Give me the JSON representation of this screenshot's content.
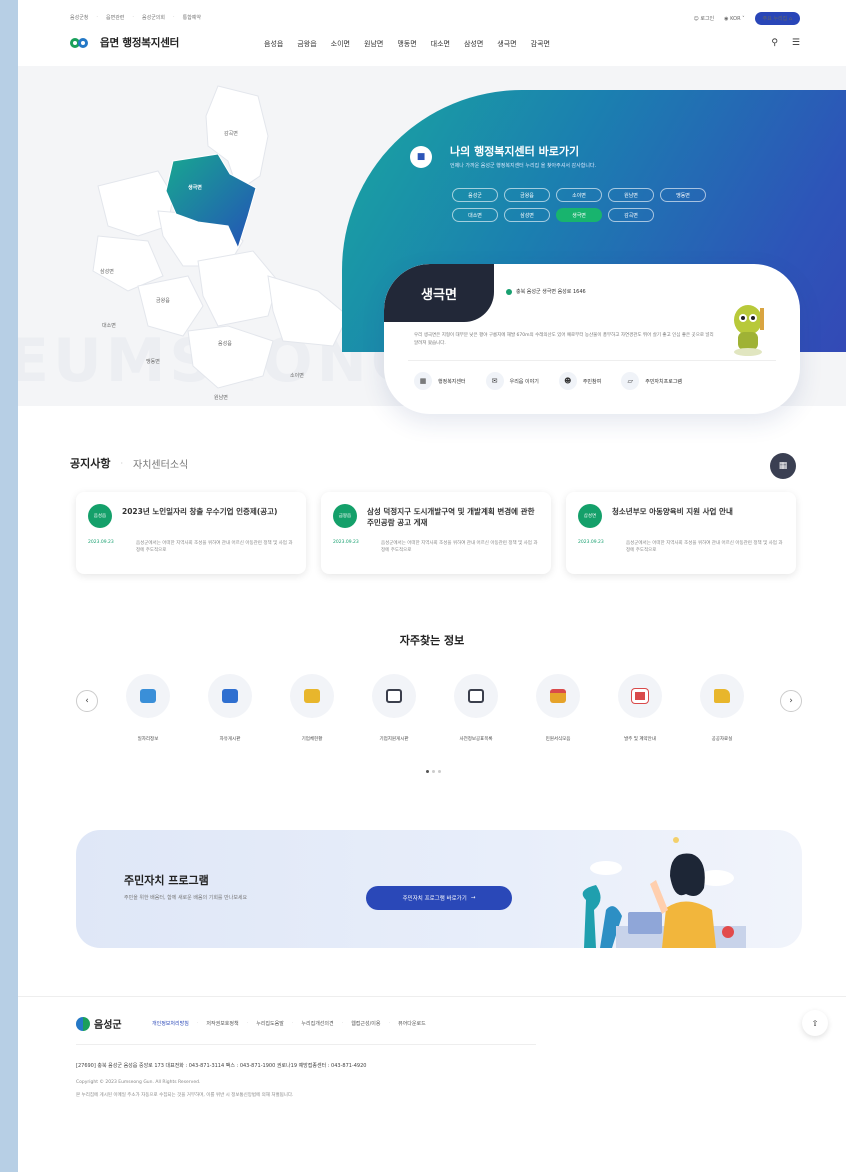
{
  "util": {
    "links": [
      "음성군청",
      "읍면관련",
      "음성군의회",
      "통합예약"
    ],
    "login": "로그인",
    "lang": "KOR",
    "cta": "주요 누리집"
  },
  "header": {
    "logo_text": "읍면 행정복지센터",
    "nav": [
      "음성읍",
      "금왕읍",
      "소이면",
      "원남면",
      "맹동면",
      "대소면",
      "삼성면",
      "생극면",
      "감곡면"
    ]
  },
  "hero": {
    "watermark": "EUMSEONG",
    "map_labels": [
      {
        "name": "감곡면",
        "active": false
      },
      {
        "name": "생극면",
        "active": true
      },
      {
        "name": "삼성면",
        "active": false
      },
      {
        "name": "금왕읍",
        "active": false
      },
      {
        "name": "대소면",
        "active": false
      },
      {
        "name": "음성읍",
        "active": false
      },
      {
        "name": "맹동면",
        "active": false
      },
      {
        "name": "소이면",
        "active": false
      },
      {
        "name": "원남면",
        "active": false
      }
    ],
    "panel_title": "나의 행정복지센터 바로가기",
    "panel_sub": "언제나 가까운 음성군 행정복지센터 누리집 을 찾아주셔서 감사합니다.",
    "chips": [
      {
        "label": "음성군",
        "active": false
      },
      {
        "label": "금왕읍",
        "active": false
      },
      {
        "label": "소이면",
        "active": false
      },
      {
        "label": "원남면",
        "active": false
      },
      {
        "label": "맹동면",
        "active": false
      },
      {
        "label": "대소면",
        "active": false
      },
      {
        "label": "삼성면",
        "active": false
      },
      {
        "label": "생극면",
        "active": true
      },
      {
        "label": "감곡면",
        "active": false
      }
    ],
    "card": {
      "name": "생극면",
      "address": "충북 음성군 생극면 음성로 1646",
      "desc": "우리 생극면은 지형이 대부분 낮은 평야 구릉지에 해발 670m의 수레의산도 있어 예로부터 농산물이 풍부하고 자연경관도 뛰어 살기 좋고 인심 좋은 곳으로 널리 알려져 왔습니다.",
      "links": [
        {
          "label": "행정복지센터",
          "icon": "building-icon"
        },
        {
          "label": "우리읍 이야기",
          "icon": "chat-icon"
        },
        {
          "label": "주민참여",
          "icon": "people-icon"
        },
        {
          "label": "주민자치프로그램",
          "icon": "program-icon"
        }
      ]
    }
  },
  "notices": {
    "tab_active": "공지사항",
    "tab_inactive": "자치센터소식",
    "items": [
      {
        "badge": "음성읍",
        "title": "2023년 노인일자리 창출 우수기업 인증제(공고)",
        "date": "2023.09.23",
        "body": "음성군에서는 어떠한 지역사회 조성을 위하여 관내 어르신 아동관련 정책 및 사업 과정에 주도적으로"
      },
      {
        "badge": "금왕읍",
        "title": "삼성 덕정지구 도시개발구역 및 개발계획 변경에 관한 주민공람 공고 게재",
        "date": "2023.09.23",
        "body": "음성군에서는 어떠한 지역사회 조성을 위하여 관내 어르신 아동관련 정책 및 사업 과정에 주도적으로"
      },
      {
        "badge": "삼성면",
        "title": "청소년부모 아동양육비 지원 사업 안내",
        "date": "2023.09.23",
        "body": "음성군에서는 어떠한 지역사회 조성을 위하여 관내 어르신 아동관련 정책 및 사업 과정에 주도적으로"
      }
    ]
  },
  "quick": {
    "title": "자주찾는 정보",
    "items": [
      {
        "label": "일자리정보",
        "icon": "job-icon",
        "color": "#3a8fd8"
      },
      {
        "label": "자유게시판",
        "icon": "board-icon",
        "color": "#2f6fd0"
      },
      {
        "label": "기업체현황",
        "icon": "company-icon",
        "color": "#e8b62c"
      },
      {
        "label": "기업지원게시판",
        "icon": "clipboard-icon",
        "color": "#3b3f4c"
      },
      {
        "label": "사전정보공표목록",
        "icon": "calendar-icon",
        "color": "#3b3f4c"
      },
      {
        "label": "민원서식모음",
        "icon": "form-icon",
        "color": "#e6a32a"
      },
      {
        "label": "발주 및 계약안내",
        "icon": "contract-icon",
        "color": "#d94a4a"
      },
      {
        "label": "공공자료실",
        "icon": "folder-icon",
        "color": "#e8b62c"
      }
    ]
  },
  "banner": {
    "title": "주민자치 프로그램",
    "subtitle": "주민을 위한 배움터, 함께 새로운 배움의 기회를 만나보세요",
    "button": "주민자치 프로그램 바로가기"
  },
  "footer": {
    "logo": "음성군",
    "links": [
      "개인정보처리방침",
      "저작권보호정책",
      "누리집도움말",
      "누리집개선의견",
      "뷰어다운로드"
    ],
    "links_extra": "웹접근성/이용",
    "address": "[27690] 충북 음성군 음성읍 중앙로 173   대표전화 : 043-871-3114   팩스 : 043-871-1900   권로나19 예방접종센터 : 043-871-4920",
    "copyright": "Copyright © 2023 Eumseong Gun. All Rights Reserved.",
    "note": "본 누리집에 게시된 이메일 주소가 자동으로 수집되는 것을 거부하며, 이를 위반 시 정보통신망법에 의해 처벌됩니다."
  }
}
